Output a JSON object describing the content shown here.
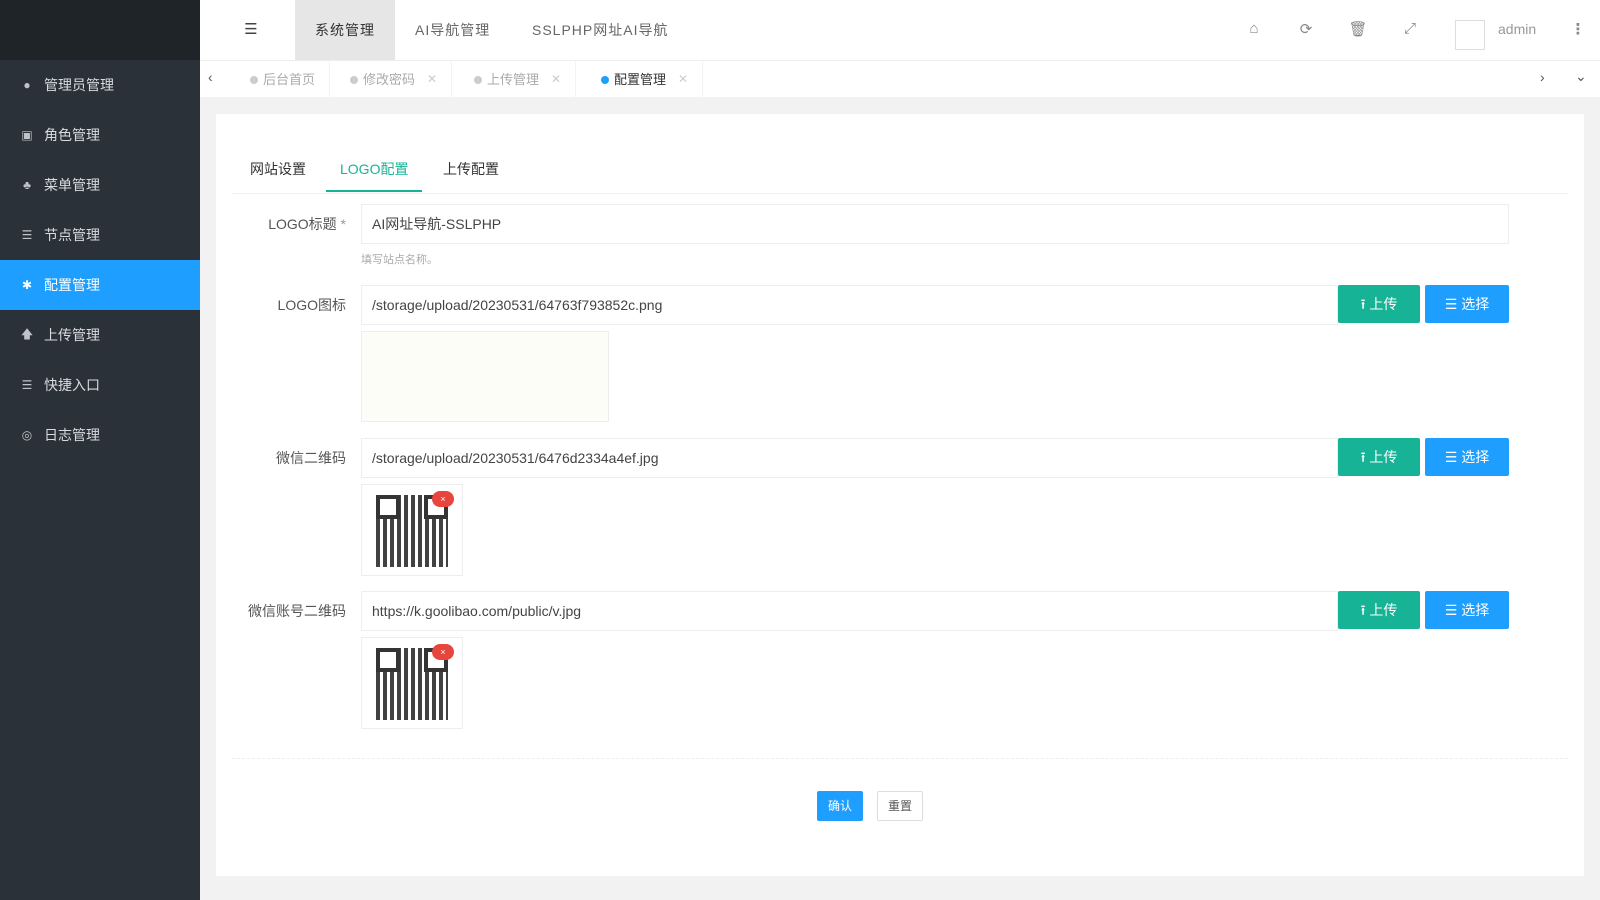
{
  "sidebar": {
    "items": [
      {
        "label": "管理员管理",
        "icon": "user-icon"
      },
      {
        "label": "角色管理",
        "icon": "role-icon"
      },
      {
        "label": "菜单管理",
        "icon": "tree-icon"
      },
      {
        "label": "节点管理",
        "icon": "list-icon"
      },
      {
        "label": "配置管理",
        "icon": "gear-icon",
        "active": true
      },
      {
        "label": "上传管理",
        "icon": "upload-icon"
      },
      {
        "label": "快捷入口",
        "icon": "list-icon"
      },
      {
        "label": "日志管理",
        "icon": "log-icon"
      }
    ]
  },
  "header": {
    "tabs": [
      "系统管理",
      "AI导航管理",
      "SSLPHP网址AI导航"
    ],
    "user": "admin"
  },
  "page_tabs": [
    "后台首页",
    "修改密码",
    "上传管理",
    "配置管理"
  ],
  "content_tabs": [
    "网站设置",
    "LOGO配置",
    "上传配置"
  ],
  "form": {
    "logo_title_label": "LOGO标题",
    "required_mark": "*",
    "logo_title_value": "AI网址导航-SSLPHP",
    "logo_title_help": "填写站点名称。",
    "logo_icon_label": "LOGO图标",
    "logo_icon_value": "/storage/upload/20230531/64763f793852c.png",
    "wechat_qr_label": "微信二维码",
    "wechat_qr_value": "/storage/upload/20230531/6476d2334a4ef.jpg",
    "wechat_account_qr_label": "微信账号二维码",
    "wechat_account_qr_value": "https://k.goolibao.com/public/v.jpg",
    "upload_label": "上传",
    "select_label": "选择",
    "delete_mark": "×",
    "confirm_label": "确认",
    "reset_label": "重置"
  },
  "colors": {
    "primary": "#1e9fff",
    "green": "#16b397",
    "sidebar": "#2b3138"
  }
}
